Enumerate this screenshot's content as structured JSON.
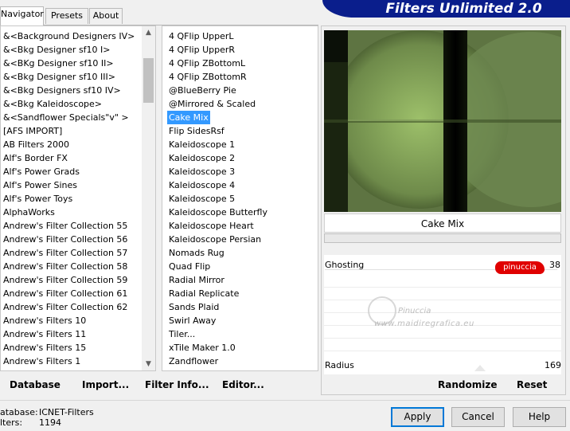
{
  "title": "Filters Unlimited 2.0",
  "tabs": [
    "Navigator",
    "Presets",
    "About"
  ],
  "categories": [
    "&<Background Designers IV>",
    "&<Bkg Designer sf10 I>",
    "&<BKg Designer sf10 II>",
    "&<Bkg Designer sf10 III>",
    "&<Bkg Designers sf10 IV>",
    "&<Bkg Kaleidoscope>",
    "&<Sandflower Specials\"v\" >",
    "[AFS IMPORT]",
    "AB Filters 2000",
    "Alf's Border FX",
    "Alf's Power Grads",
    "Alf's Power Sines",
    "Alf's Power Toys",
    "AlphaWorks",
    "Andrew's Filter Collection 55",
    "Andrew's Filter Collection 56",
    "Andrew's Filter Collection 57",
    "Andrew's Filter Collection 58",
    "Andrew's Filter Collection 59",
    "Andrew's Filter Collection 61",
    "Andrew's Filter Collection 62",
    "Andrew's Filters 10",
    "Andrew's Filters 11",
    "Andrew's Filters 15",
    "Andrew's Filters 1"
  ],
  "filters": [
    "4 QFlip UpperL",
    "4 QFlip UpperR",
    "4 QFlip ZBottomL",
    "4 QFlip ZBottomR",
    "@BlueBerry Pie",
    "@Mirrored & Scaled",
    "Cake Mix",
    "Flip SidesRsf",
    "Kaleidoscope 1",
    "Kaleidoscope 2",
    "Kaleidoscope 3",
    "Kaleidoscope 4",
    "Kaleidoscope 5",
    "Kaleidoscope Butterfly",
    "Kaleidoscope Heart",
    "Kaleidoscope Persian",
    "Nomads Rug",
    "Quad Flip",
    "Radial Mirror",
    "Radial Replicate",
    "Sands Plaid",
    "Swirl Away",
    "Tiler...",
    "xTile Maker 1.0",
    "Zandflower"
  ],
  "selected_filter_index": 6,
  "filter_name": "Cake Mix",
  "params": {
    "ghosting_label": "Ghosting",
    "ghosting_value": "38",
    "radius_label": "Radius",
    "radius_value": "169"
  },
  "watermark": {
    "badge": "pinuccia",
    "line1": "Pinuccia",
    "line2": "www.maidiregrafica.eu"
  },
  "bottom_bar": {
    "database": "Database",
    "import": "Import...",
    "filter_info": "Filter Info...",
    "editor": "Editor...",
    "randomize": "Randomize",
    "reset": "Reset"
  },
  "status": {
    "database_label": "atabase:",
    "database_value": "ICNET-Filters",
    "filters_label": "lters:",
    "filters_value": "1194"
  },
  "buttons": {
    "apply": "Apply",
    "cancel": "Cancel",
    "help": "Help"
  },
  "colors": {
    "banner": "#0a1e8c",
    "selection": "#3399ff",
    "preview_green": "#5a6e3c",
    "badge_red": "#e00000"
  }
}
